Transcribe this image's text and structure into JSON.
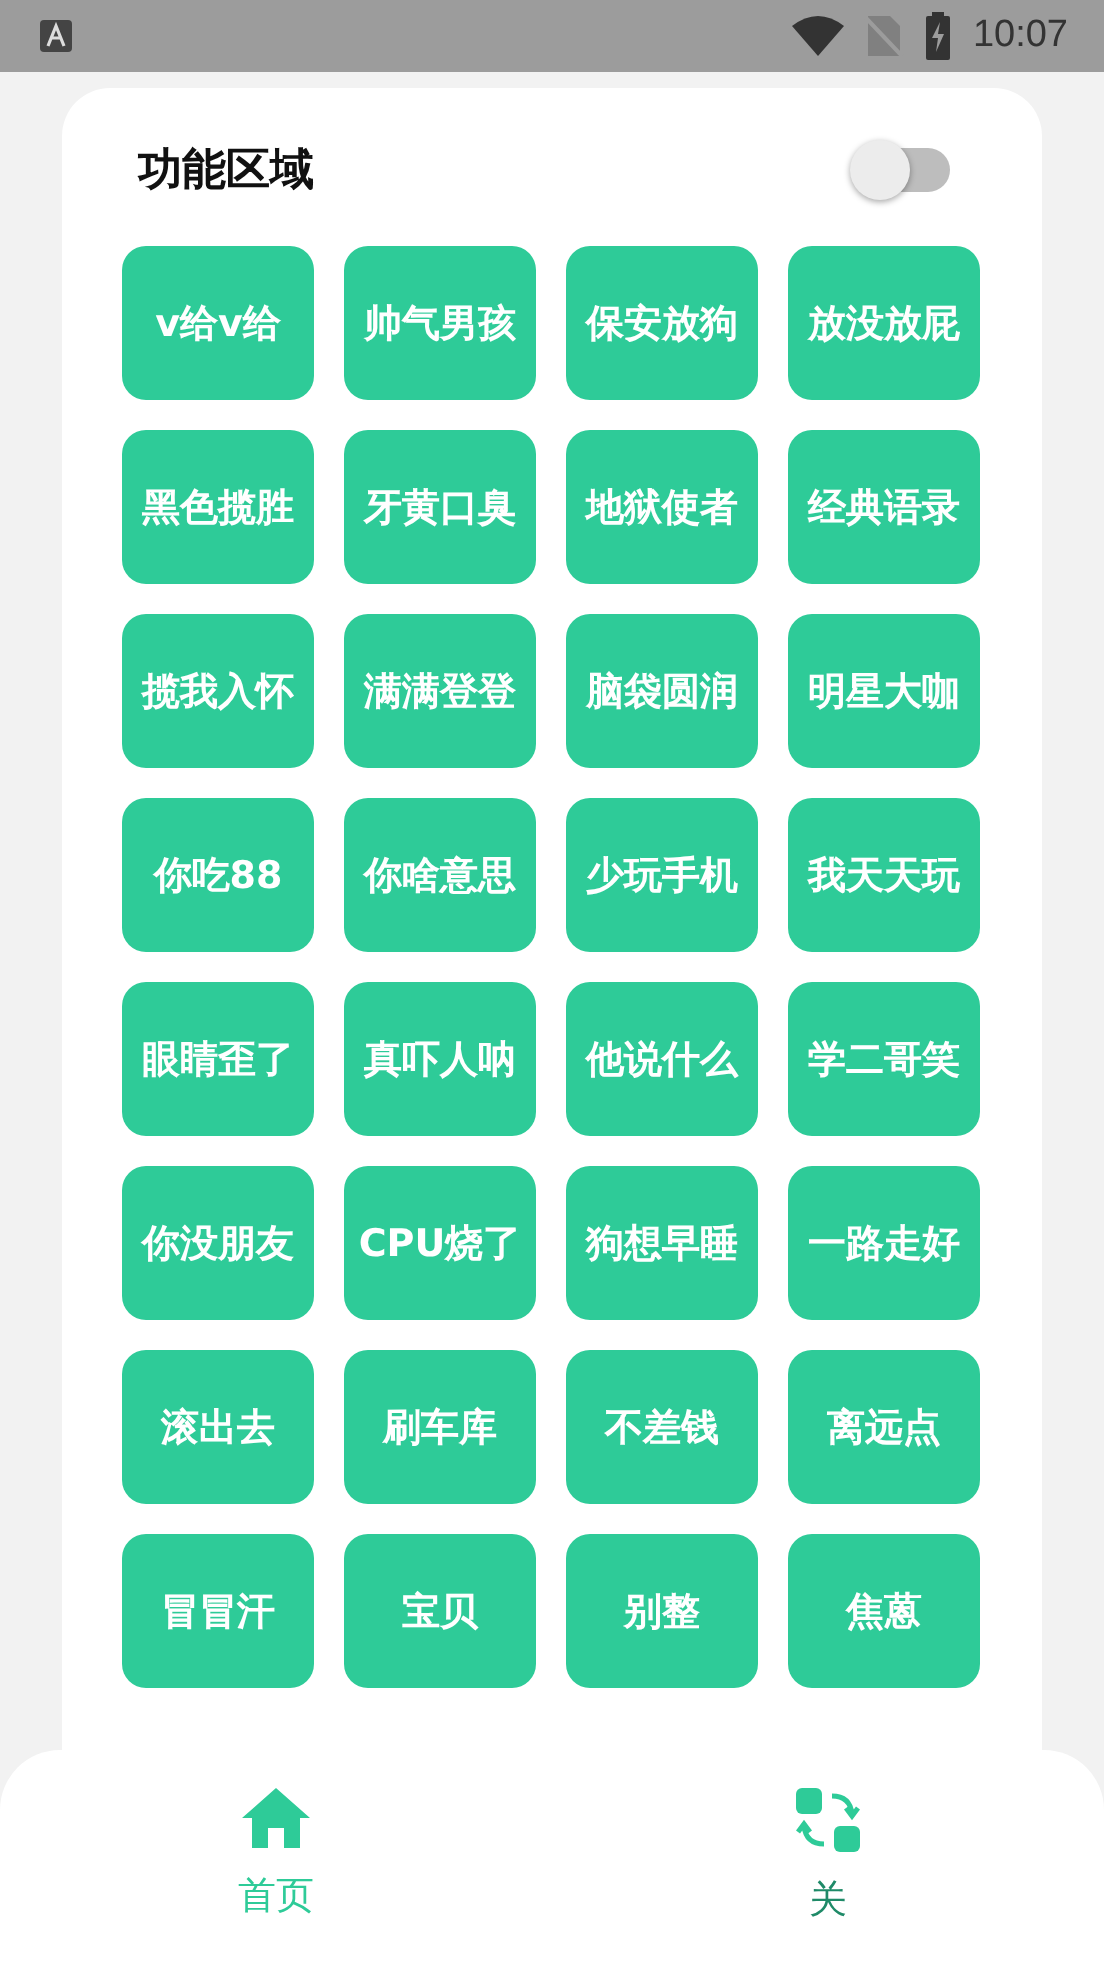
{
  "status_bar": {
    "time": "10:07"
  },
  "panel": {
    "title": "功能区域",
    "toggle": {
      "on": false
    }
  },
  "buttons": [
    {
      "label": "v给v给"
    },
    {
      "label": "帅气男孩"
    },
    {
      "label": "保安放狗"
    },
    {
      "label": "放没放屁"
    },
    {
      "label": "黑色揽胜"
    },
    {
      "label": "牙黄口臭"
    },
    {
      "label": "地狱使者"
    },
    {
      "label": "经典语录"
    },
    {
      "label": "揽我入怀"
    },
    {
      "label": "满满登登"
    },
    {
      "label": "脑袋圆润"
    },
    {
      "label": "明星大咖"
    },
    {
      "label": "你吃88"
    },
    {
      "label": "你啥意思"
    },
    {
      "label": "少玩手机"
    },
    {
      "label": "我天天玩"
    },
    {
      "label": "眼睛歪了"
    },
    {
      "label": "真吓人呐"
    },
    {
      "label": "他说什么"
    },
    {
      "label": "学二哥笑"
    },
    {
      "label": "你没朋友"
    },
    {
      "label": "CPU烧了"
    },
    {
      "label": "狗想早睡"
    },
    {
      "label": "一路走好"
    },
    {
      "label": "滚出去"
    },
    {
      "label": "刷车库"
    },
    {
      "label": "不差钱"
    },
    {
      "label": "离远点"
    },
    {
      "label": "冒冒汗"
    },
    {
      "label": "宝贝"
    },
    {
      "label": "别整"
    },
    {
      "label": "焦蒽"
    }
  ],
  "nav": [
    {
      "label": "首页",
      "kind": "home",
      "selected": true
    },
    {
      "label": "关",
      "kind": "switch",
      "selected": false
    }
  ]
}
